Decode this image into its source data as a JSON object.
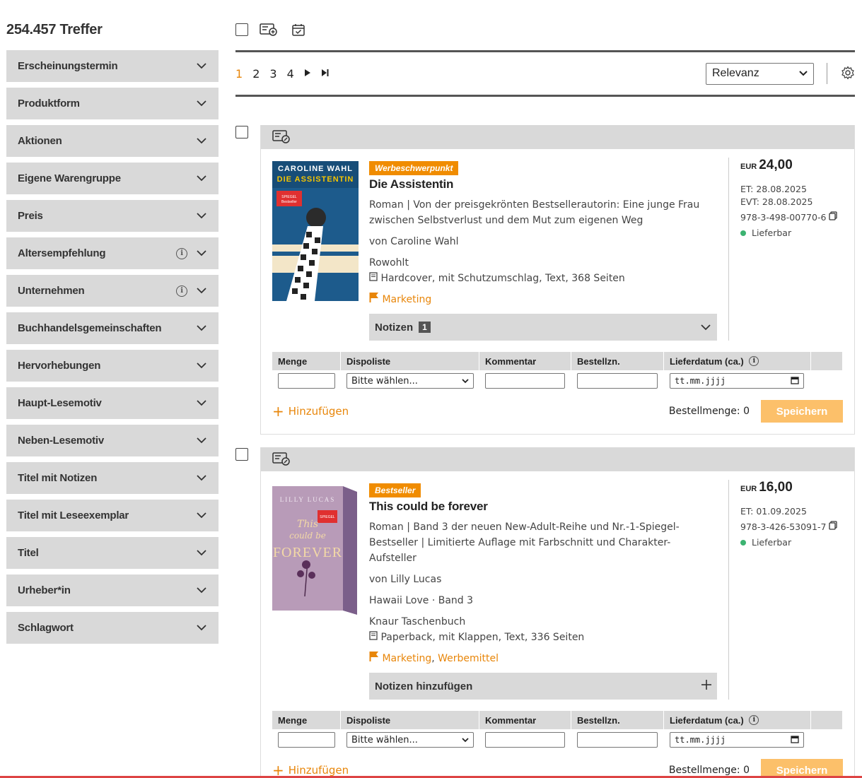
{
  "sidebar": {
    "hits": "254.457 Treffer",
    "facets": [
      {
        "label": "Erscheinungstermin",
        "info": false
      },
      {
        "label": "Produktform",
        "info": false
      },
      {
        "label": "Aktionen",
        "info": false
      },
      {
        "label": "Eigene Warengruppe",
        "info": false
      },
      {
        "label": "Preis",
        "info": false
      },
      {
        "label": "Altersempfehlung",
        "info": true
      },
      {
        "label": "Unternehmen",
        "info": true
      },
      {
        "label": "Buchhandelsgemeinschaften",
        "info": false
      },
      {
        "label": "Hervorhebungen",
        "info": false
      },
      {
        "label": "Haupt-Lesemotiv",
        "info": false
      },
      {
        "label": "Neben-Lesemotiv",
        "info": false
      },
      {
        "label": "Titel mit Notizen",
        "info": false
      },
      {
        "label": "Titel mit Leseexemplar",
        "info": false
      },
      {
        "label": "Titel",
        "info": false
      },
      {
        "label": "Urheber*in",
        "info": false
      },
      {
        "label": "Schlagwort",
        "info": false
      }
    ]
  },
  "pager": {
    "pages": [
      "1",
      "2",
      "3",
      "4"
    ],
    "active": "1",
    "sort": "Relevanz"
  },
  "order_labels": {
    "menge": "Menge",
    "dispoliste": "Dispoliste",
    "kommentar": "Kommentar",
    "bestellnr": "Bestellzn.",
    "lieferdatum": "Lieferdatum (ca.)",
    "select_placeholder": "Bitte wählen...",
    "date_placeholder": "tt.mm.jjjj",
    "add": "Hinzufügen",
    "bestellmenge": "Bestellmenge: 0",
    "save": "Speichern"
  },
  "products": [
    {
      "badge": "Werbeschwerpunkt",
      "title": "Die Assistentin",
      "subtitle": "Roman | Von der preisgekrönten Bestsellerautorin: Eine junge Frau zwischen Selbstverlust und dem Mut zum eigenen Weg",
      "author": "von Caroline Wahl",
      "series": "",
      "publisher": "Rowohlt",
      "format": "Hardcover, mit Schutzumschlag, Text, 368 Seiten",
      "links": [
        "Marketing"
      ],
      "notes_label": "Notizen",
      "notes_count": "1",
      "currency": "EUR",
      "price": "24,00",
      "et": "ET: 28.08.2025",
      "evt": "EVT: 28.08.2025",
      "isbn": "978-3-498-00770-6",
      "availability": "Lieferbar",
      "cover_text_1": "CAROLINE WAHL",
      "cover_text_2": "DIE ASSISTENTIN",
      "cover_sticker": "SPIEGEL Bestseller Platz 1",
      "cover_color": "#1d5b8c"
    },
    {
      "badge": "Bestseller",
      "title": "This could be forever",
      "subtitle": "Roman | Band 3 der neuen New-Adult-Reihe und Nr.-1-Spiegel-Bestseller | Limitierte Auflage mit Farbschnitt und Charakter-Aufsteller",
      "author": "von Lilly Lucas",
      "series": "Hawaii Love · Band 3",
      "publisher": "Knaur Taschenbuch",
      "format": "Paperback, mit Klappen, Text, 336 Seiten",
      "links": [
        "Marketing",
        "Werbemittel"
      ],
      "notes_label": "Notizen hinzufügen",
      "notes_count": "",
      "currency": "EUR",
      "price": "16,00",
      "et": "ET: 01.09.2025",
      "evt": "",
      "isbn": "978-3-426-53091-7",
      "availability": "Lieferbar",
      "cover_text_1": "LILLY LUCAS",
      "cover_text_2": "FOREVER",
      "cover_sticker": "SPIEGEL Bestseller Platz 1",
      "cover_color": "#b89bb8"
    }
  ]
}
